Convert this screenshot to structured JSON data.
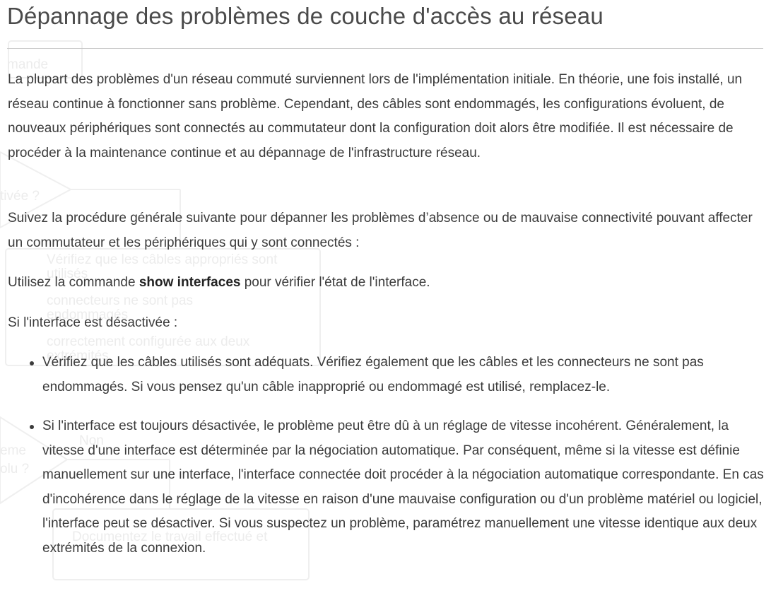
{
  "title": "Dépannage des problèmes de couche d'accès au réseau",
  "paragraphs": [
    "La plupart des problèmes d'un réseau commuté surviennent lors de l'implémentation initiale. En théorie, une fois installé, un réseau continue à fonctionner sans problème. Cependant, des câbles sont endommagés, les configurations évoluent, de nouveaux périphériques sont connectés au commutateur dont la configuration doit alors être modifiée. Il est nécessaire de procéder à la maintenance continue et au dépannage de l'infrastructure réseau.",
    "Suivez la procédure générale suivante pour dépanner les problèmes d’absence ou de mauvaise connectivité pouvant affecter un commutateur et les périphériques qui y sont connectés :"
  ],
  "command_line": {
    "before": "Utilisez la commande ",
    "command": "show interfaces",
    "after": " pour vérifier l'état de l'interface."
  },
  "condition": "Si l'interface est désactivée :",
  "bullets": [
    "Vérifiez que les câbles utilisés sont adéquats. Vérifiez également que les câbles et les connecteurs ne sont pas endommagés. Si vous pensez qu'un câble inapproprié ou endommagé est utilisé, remplacez-le.",
    "Si l'interface est toujours désactivée, le problème peut être dû à un réglage de vitesse incohérent. Généralement, la vitesse d'une interface est déterminée par la négociation automatique. Par conséquent, même si la vitesse est définie manuellement sur une interface, l'interface connectée doit procéder à la négociation automatique correspondante. En cas d'incohérence dans le réglage de la vitesse en raison d'une mauvaise configuration ou d'un problème matériel ou logiciel, l'interface peut se désactiver. Si vous suspectez un problème, paramétrez manuellement une vitesse identique aux deux extrémités de la connexion."
  ],
  "background_flowchart": {
    "labels": [
      "mande",
      "tivée ?",
      "Vérifiez que les câbles appropriés sont",
      "utilisés",
      "connecteurs ne sont pas",
      "endommagés",
      "correctement configurée aux deux",
      "extrémités",
      "Non",
      "eme",
      "olu ?",
      "Documentez le travail effectué et"
    ]
  }
}
